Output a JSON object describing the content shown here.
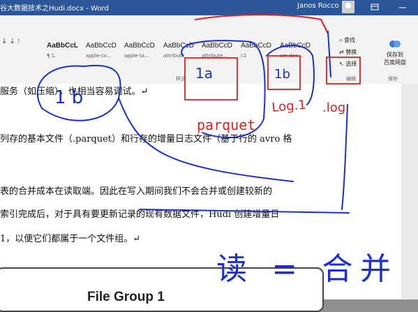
{
  "window": {
    "title": "谷大数据技术之Hudi.docx  -  Word",
    "user": "Janos Rocco"
  },
  "ribbon": {
    "styles": [
      {
        "sample": "AaBbCcL",
        "name": "¶ 1."
      },
      {
        "sample": "AaBbCcD",
        "name": "apple-co..."
      },
      {
        "sample": "AaBbCcD",
        "name": "apple-ta..."
      },
      {
        "sample": "AaBbCcD",
        "name": "attribute"
      },
      {
        "sample": "AaBbCcD",
        "name": "attribute..."
      },
      {
        "sample": "AaBbCcD",
        "name": "c1"
      },
      {
        "sample": "AaBbCcD",
        "name": "cm-doc..."
      }
    ],
    "styles_group_label": "样式",
    "edit_find": "查找",
    "edit_replace": "替换",
    "edit_select": "选择",
    "edit_group_label": "编辑",
    "save_baidu_line1": "保存到",
    "save_baidu_line2": "百度网盘",
    "save_group_label": "保存"
  },
  "document": {
    "lines": [
      "服务（如压缩），也相当容易调试。↵",
      "列存的基本文件（.parquet）和行存的增量日志文件（基于行的 avro 格",
      "表的合并成本在读取端。因此在写入期间我们不会合并或创建较新的",
      "索引完成后，对于具有要更新记录的现有数据文件，Hudi 创建增量日",
      "1，以便它们都属于一个文件组。↵"
    ],
    "figure_title": "File Group 1"
  },
  "annotations": {
    "box_a": "1a",
    "box_b": "1b",
    "parquet": "parquet",
    "log1": "Log.1",
    "log2": ".log",
    "circle": "1 b",
    "read_eq_write": "读 = 合并"
  },
  "colors": {
    "ink": "#1a2fd0",
    "red": "#e02020",
    "accent": "#2b579a"
  }
}
